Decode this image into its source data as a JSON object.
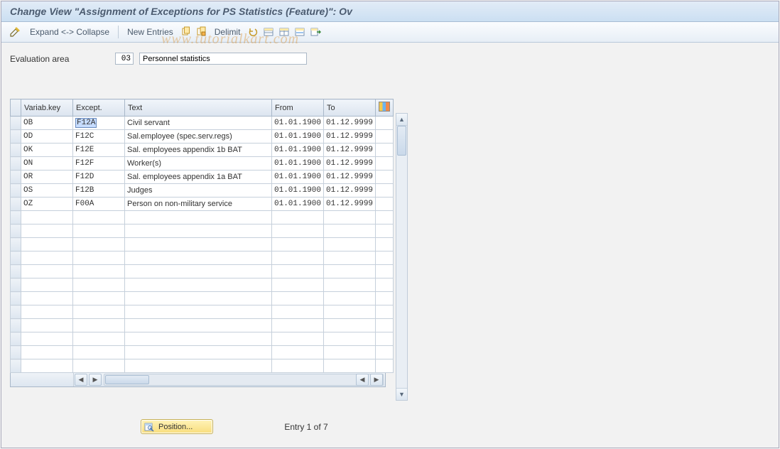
{
  "title": "Change View \"Assignment of Exceptions for PS Statistics (Feature)\": Ov",
  "toolbar": {
    "expand_collapse": "Expand <-> Collapse",
    "new_entries": "New Entries",
    "delimit": "Delimit"
  },
  "eval": {
    "label": "Evaluation area",
    "code": "03",
    "desc": "Personnel statistics"
  },
  "columns": {
    "vkey": "Variab.key",
    "except": "Except.",
    "text": "Text",
    "from": "From",
    "to": "To"
  },
  "rows": [
    {
      "vkey": "OB",
      "except": "F12A",
      "text": "Civil servant",
      "from": "01.01.1900",
      "to": "01.12.9999"
    },
    {
      "vkey": "OD",
      "except": "F12C",
      "text": "Sal.employee (spec.serv.regs)",
      "from": "01.01.1900",
      "to": "01.12.9999"
    },
    {
      "vkey": "OK",
      "except": "F12E",
      "text": "Sal. employees appendix 1b BAT",
      "from": "01.01.1900",
      "to": "01.12.9999"
    },
    {
      "vkey": "ON",
      "except": "F12F",
      "text": "Worker(s)",
      "from": "01.01.1900",
      "to": "01.12.9999"
    },
    {
      "vkey": "OR",
      "except": "F12D",
      "text": "Sal. employees appendix 1a BAT",
      "from": "01.01.1900",
      "to": "01.12.9999"
    },
    {
      "vkey": "OS",
      "except": "F12B",
      "text": "Judges",
      "from": "01.01.1900",
      "to": "01.12.9999"
    },
    {
      "vkey": "OZ",
      "except": "F00A",
      "text": "Person on non-military service",
      "from": "01.01.1900",
      "to": "01.12.9999"
    }
  ],
  "empty_rows": 12,
  "position_button": "Position...",
  "entry_text": "Entry 1 of 7",
  "watermark": "www.tutorialkart.com"
}
